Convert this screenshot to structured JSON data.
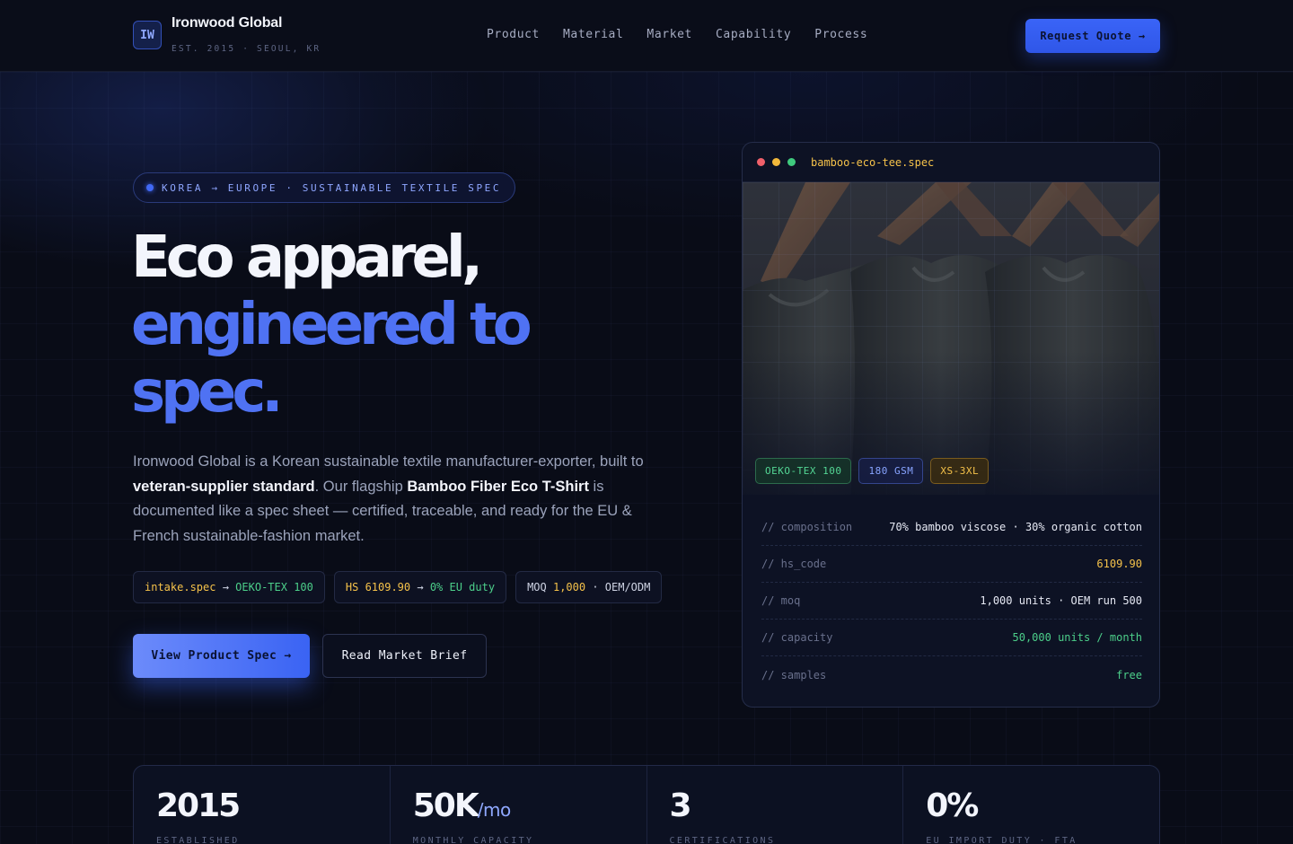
{
  "brand": {
    "logo": "IW",
    "name": "Ironwood Global",
    "sub": "EST. 2015 · SEOUL, KR"
  },
  "nav": {
    "items": [
      "Product",
      "Material",
      "Market",
      "Capability",
      "Process"
    ]
  },
  "header": {
    "cta": "Request Quote →"
  },
  "hero": {
    "tagline": "KOREA → EUROPE · SUSTAINABLE TEXTILE SPEC",
    "headline_line1": "Eco apparel,",
    "headline_line2": "engineered to",
    "headline_line3": "spec.",
    "lead": {
      "p1": "Ironwood Global is a Korean sustainable textile manufacturer-exporter, built to ",
      "b1": "veteran-supplier standard",
      "p2": ". Our flagship ",
      "b2": "Bamboo Fiber Eco T-Shirt",
      "p3": " is documented like a spec sheet — certified, traceable, and ready for the EU & French sustainable-fashion market."
    },
    "chips": [
      {
        "a": "intake.spec",
        "arrow": " → ",
        "b": "OEKO-TEX 100"
      },
      {
        "a": "HS ",
        "a2": "6109.90",
        "arrow": " → ",
        "b": "0% EU duty"
      },
      {
        "a": "MOQ ",
        "a2": "1,000",
        "rest": " · OEM/ODM"
      }
    ],
    "primary_cta": "View Product Spec →",
    "secondary_cta": "Read Market Brief"
  },
  "spec_card": {
    "filename": "bamboo-eco-tee.spec",
    "badges": [
      "OEKO-TEX 100",
      "180 GSM",
      "XS-3XL"
    ],
    "rows": [
      {
        "key": "// composition",
        "value": "70% bamboo viscose · 30% organic cotton"
      },
      {
        "key": "// hs_code",
        "value": "6109.90"
      },
      {
        "key": "// moq",
        "value": "1,000 units · OEM run 500"
      },
      {
        "key": "// capacity",
        "value": "50,000 units / month"
      },
      {
        "key": "// samples",
        "value": "free"
      }
    ]
  },
  "stats": [
    {
      "num": "2015",
      "unit": "",
      "label": "ESTABLISHED"
    },
    {
      "num": "50K",
      "unit": "/mo",
      "label": "MONTHLY CAPACITY"
    },
    {
      "num": "3",
      "unit": "",
      "label": "CERTIFICATIONS"
    },
    {
      "num": "0%",
      "unit": "",
      "label": "EU IMPORT DUTY · FTA"
    }
  ],
  "colors": {
    "accent": "#3a64f7",
    "amber": "#f5c24a",
    "green": "#4ccf8a",
    "background": "#090c17"
  }
}
